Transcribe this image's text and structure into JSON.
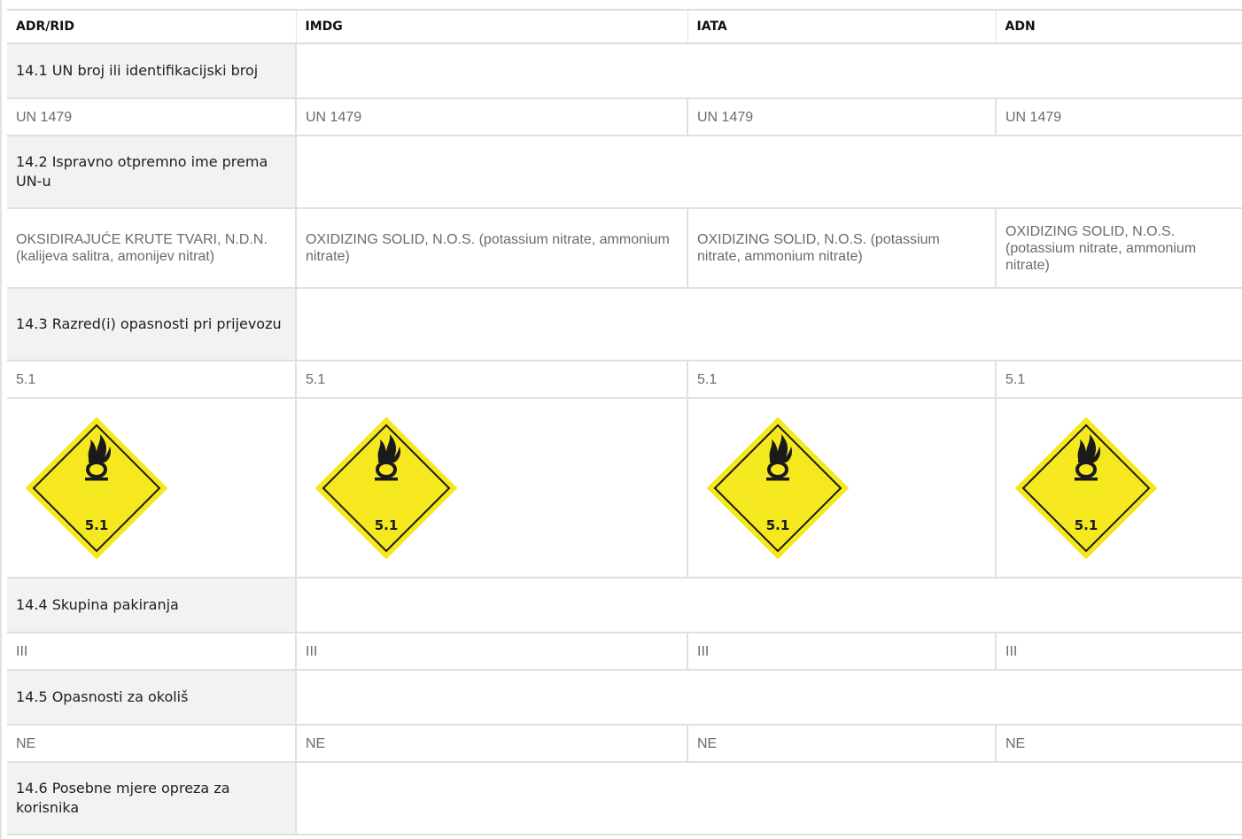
{
  "table": {
    "headers": [
      "ADR/RID",
      "IMDG",
      "IATA",
      "ADN"
    ],
    "sections": [
      {
        "title": "14.1 UN broj ili identifikacijski broj",
        "values": [
          "UN 1479",
          "UN 1479",
          "UN 1479",
          "UN 1479"
        ]
      },
      {
        "title": "14.2 Ispravno otpremno ime prema UN-u",
        "values": [
          "OKSIDIRAJUĆE KRUTE TVARI, N.D.N. (kalijeva salitra, amonijev nitrat)",
          "OXIDIZING SOLID, N.O.S. (potassium nitrate, ammonium nitrate)",
          "OXIDIZING SOLID, N.O.S. (potassium nitrate, ammonium nitrate)",
          "OXIDIZING SOLID, N.O.S. (potassium nitrate, ammonium nitrate)"
        ]
      },
      {
        "title": "14.3 Razred(i) opasnosti pri prijevozu",
        "values": [
          "5.1",
          "5.1",
          "5.1",
          "5.1"
        ],
        "label_text": [
          "5.1",
          "5.1",
          "5.1",
          "5.1"
        ]
      },
      {
        "title": "14.4 Skupina pakiranja",
        "values": [
          "III",
          "III",
          "III",
          "III"
        ]
      },
      {
        "title": "14.5 Opasnosti za okoliš",
        "values": [
          "NE",
          "NE",
          "NE",
          "NE"
        ]
      },
      {
        "title": "14.6 Posebne mjere opreza za korisnika",
        "values": []
      }
    ]
  },
  "hazard_label": {
    "icon": "flame-over-circle-icon",
    "fill_color": "#f5e81e",
    "border_color": "#1a1a1a"
  }
}
